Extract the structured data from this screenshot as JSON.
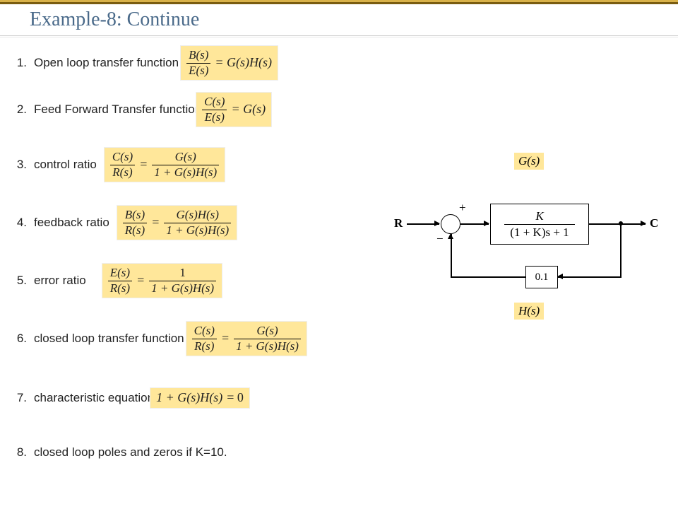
{
  "title": "Example-8: Continue",
  "items": [
    {
      "num": "1.",
      "label": "Open loop transfer function"
    },
    {
      "num": "2.",
      "label": "Feed Forward Transfer function"
    },
    {
      "num": "3.",
      "label": "control ratio"
    },
    {
      "num": "4.",
      "label": "feedback ratio"
    },
    {
      "num": "5.",
      "label": "error ratio"
    },
    {
      "num": "6.",
      "label": "closed loop transfer function"
    },
    {
      "num": "7.",
      "label": "characteristic equation"
    },
    {
      "num": "8.",
      "label": "closed loop poles and zeros if K=10."
    }
  ],
  "eq": {
    "bs": "B(s)",
    "es": "E(s)",
    "cs": "C(s)",
    "rs": "R(s)",
    "one": "1",
    "gs": "G(s)",
    "hs": "H(s)",
    "gshs": "G(s)H(s)",
    "one_plus_gshs": "1 + G(s)H(s)",
    "eq_gshs": "= G(s)H(s)",
    "eq_gs": "= G(s)",
    "equals": "=",
    "char_zero": "= 0",
    "char_lhs": "1 + G(s)H(s)"
  },
  "diagram": {
    "gs_label": "G(s)",
    "hs_label": "H(s)",
    "r": "R",
    "c": "C",
    "plus": "+",
    "minus": "−",
    "plant_num": "K",
    "plant_den": "(1 + K)s + 1",
    "feedback": "0.1"
  }
}
